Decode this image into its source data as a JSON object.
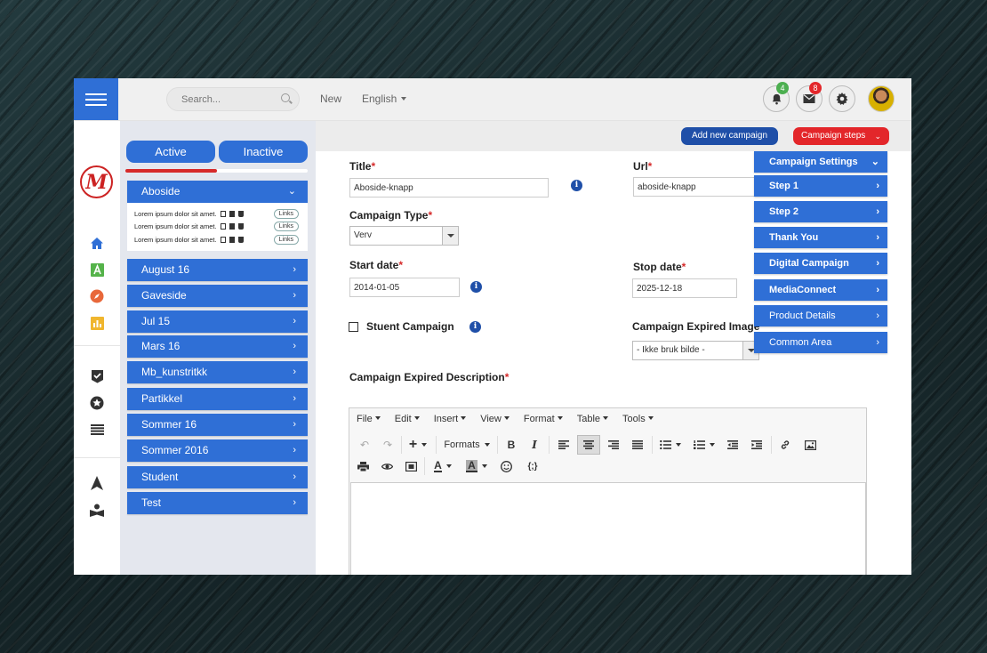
{
  "topbar": {
    "search_placeholder": "Search...",
    "new_label": "New",
    "language": "English",
    "notifications_count": "4",
    "messages_count": "8",
    "notifications_color": "#4caf50",
    "messages_color": "#e3262a"
  },
  "panel": {
    "tab_active": "Active",
    "tab_inactive": "Inactive",
    "progress": 0.5,
    "open_group": {
      "title": "Aboside",
      "rows": [
        {
          "text": "Lorem ipsum dolor sit amet.",
          "link": "Links"
        },
        {
          "text": "Lorem ipsum dolor sit amet.",
          "link": "Links"
        },
        {
          "text": "Lorem ipsum dolor sit amet.",
          "link": "Links"
        }
      ]
    },
    "groups": [
      "August 16",
      "Gaveside",
      "Jul 15",
      "Mars 16",
      "Mb_kunstritkk",
      "Partikkel",
      "Sommer 16",
      "Sommer 2016",
      "Student",
      "Test"
    ]
  },
  "actions": {
    "add_campaign": "Add new campaign",
    "campaign_steps": "Campaign steps"
  },
  "steps_menu": [
    "Campaign Settings",
    "Step 1",
    "Step 2",
    "Thank You",
    "Digital Campaign",
    "MediaConnect",
    "Product Details",
    "Common Area"
  ],
  "form": {
    "title_label": "Title",
    "title_value": "Aboside-knapp",
    "url_label": "Url",
    "url_value": "aboside-knapp",
    "type_label": "Campaign Type",
    "type_value": "Verv",
    "start_label": "Start date",
    "start_value": "2014-01-05",
    "stop_label": "Stop date",
    "stop_value": "2025-12-18",
    "student_label": "Stuent Campaign",
    "expired_image_label": "Campaign Expired Image",
    "expired_image_value": "- Ikke bruk bilde -",
    "expired_desc_label": "Campaign Expired Description",
    "required_mark": "*",
    "info_glyph": "i"
  },
  "editor": {
    "menus": [
      "File",
      "Edit",
      "Insert",
      "View",
      "Format",
      "Table",
      "Tools"
    ],
    "formats_label": "Formats"
  },
  "colors": {
    "primary": "#2f6fd6",
    "dark_blue": "#1f4fa8",
    "accent_red": "#e3262a"
  }
}
